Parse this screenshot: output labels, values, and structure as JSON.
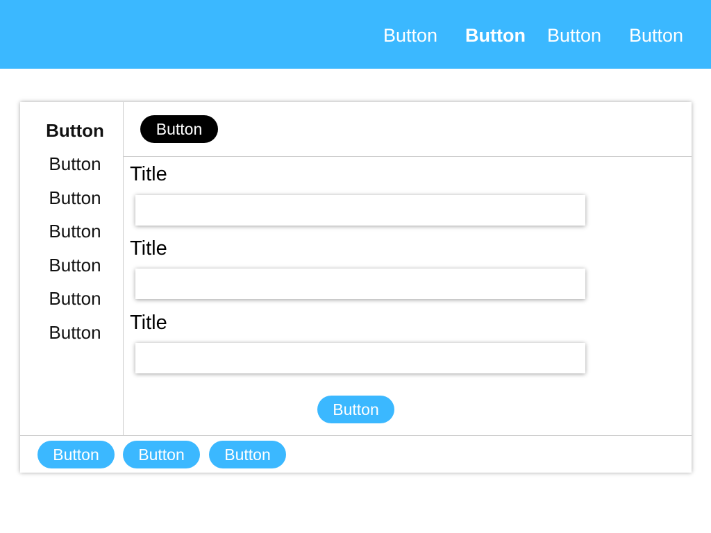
{
  "header": {
    "nav": [
      {
        "label": "Button",
        "active": false
      },
      {
        "label": "Button",
        "active": true
      },
      {
        "label": "Button",
        "active": false
      },
      {
        "label": "Button",
        "active": false
      }
    ]
  },
  "sidebar": {
    "items": [
      {
        "label": "Button",
        "active": true
      },
      {
        "label": "Button",
        "active": false
      },
      {
        "label": "Button",
        "active": false
      },
      {
        "label": "Button",
        "active": false
      },
      {
        "label": "Button",
        "active": false
      },
      {
        "label": "Button",
        "active": false
      },
      {
        "label": "Button",
        "active": false
      }
    ]
  },
  "toolbar": {
    "primary_label": "Button"
  },
  "form": {
    "fields": [
      {
        "title": "Title",
        "value": "",
        "placeholder": ""
      },
      {
        "title": "Title",
        "value": "",
        "placeholder": ""
      },
      {
        "title": "Title",
        "value": "",
        "placeholder": ""
      }
    ],
    "submit_label": "Button"
  },
  "footer": {
    "buttons": [
      {
        "label": "Button"
      },
      {
        "label": "Button"
      },
      {
        "label": "Button"
      }
    ]
  },
  "colors": {
    "accent": "#3bb8ff",
    "dark_button": "#000000",
    "divider": "#cfcfcf"
  }
}
